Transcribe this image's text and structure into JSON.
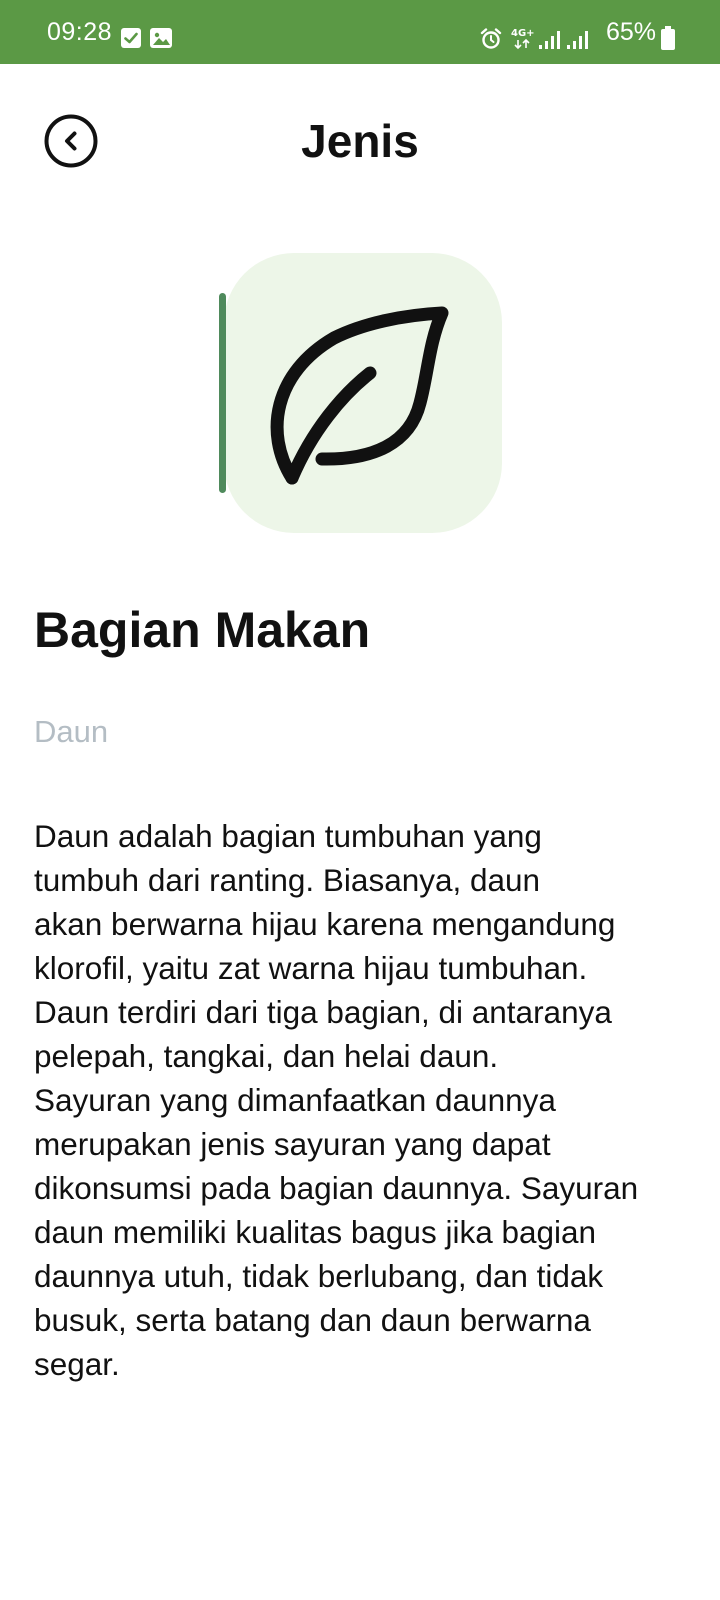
{
  "status_bar": {
    "time": "09:28",
    "network": "4G+",
    "battery": "65%",
    "colors": {
      "background": "#5b9945"
    }
  },
  "header": {
    "title": "Jenis",
    "back_icon": "chevron-left-circle-icon"
  },
  "hero": {
    "icon": "leaf-icon",
    "colors": {
      "background": "#edf6e8",
      "accent": "#4f8a5c"
    }
  },
  "content": {
    "heading": "Bagian Makan",
    "subtitle": "Daun",
    "lines": [
      "Daun adalah bagian tumbuhan yang",
      "tumbuh dari ranting. Biasanya, daun",
      "akan berwarna hijau karena mengandung",
      "klorofil, yaitu zat warna hijau tumbuhan.",
      "Daun terdiri dari tiga bagian, di antaranya",
      "pelepah, tangkai, dan helai daun.",
      "Sayuran yang dimanfaatkan daunnya",
      "merupakan jenis sayuran yang dapat",
      "dikonsumsi pada bagian daunnya. Sayuran",
      "daun memiliki kualitas bagus jika bagian",
      "daunnya utuh, tidak berlubang, dan tidak",
      "busuk, serta batang dan daun berwarna",
      "segar."
    ]
  }
}
